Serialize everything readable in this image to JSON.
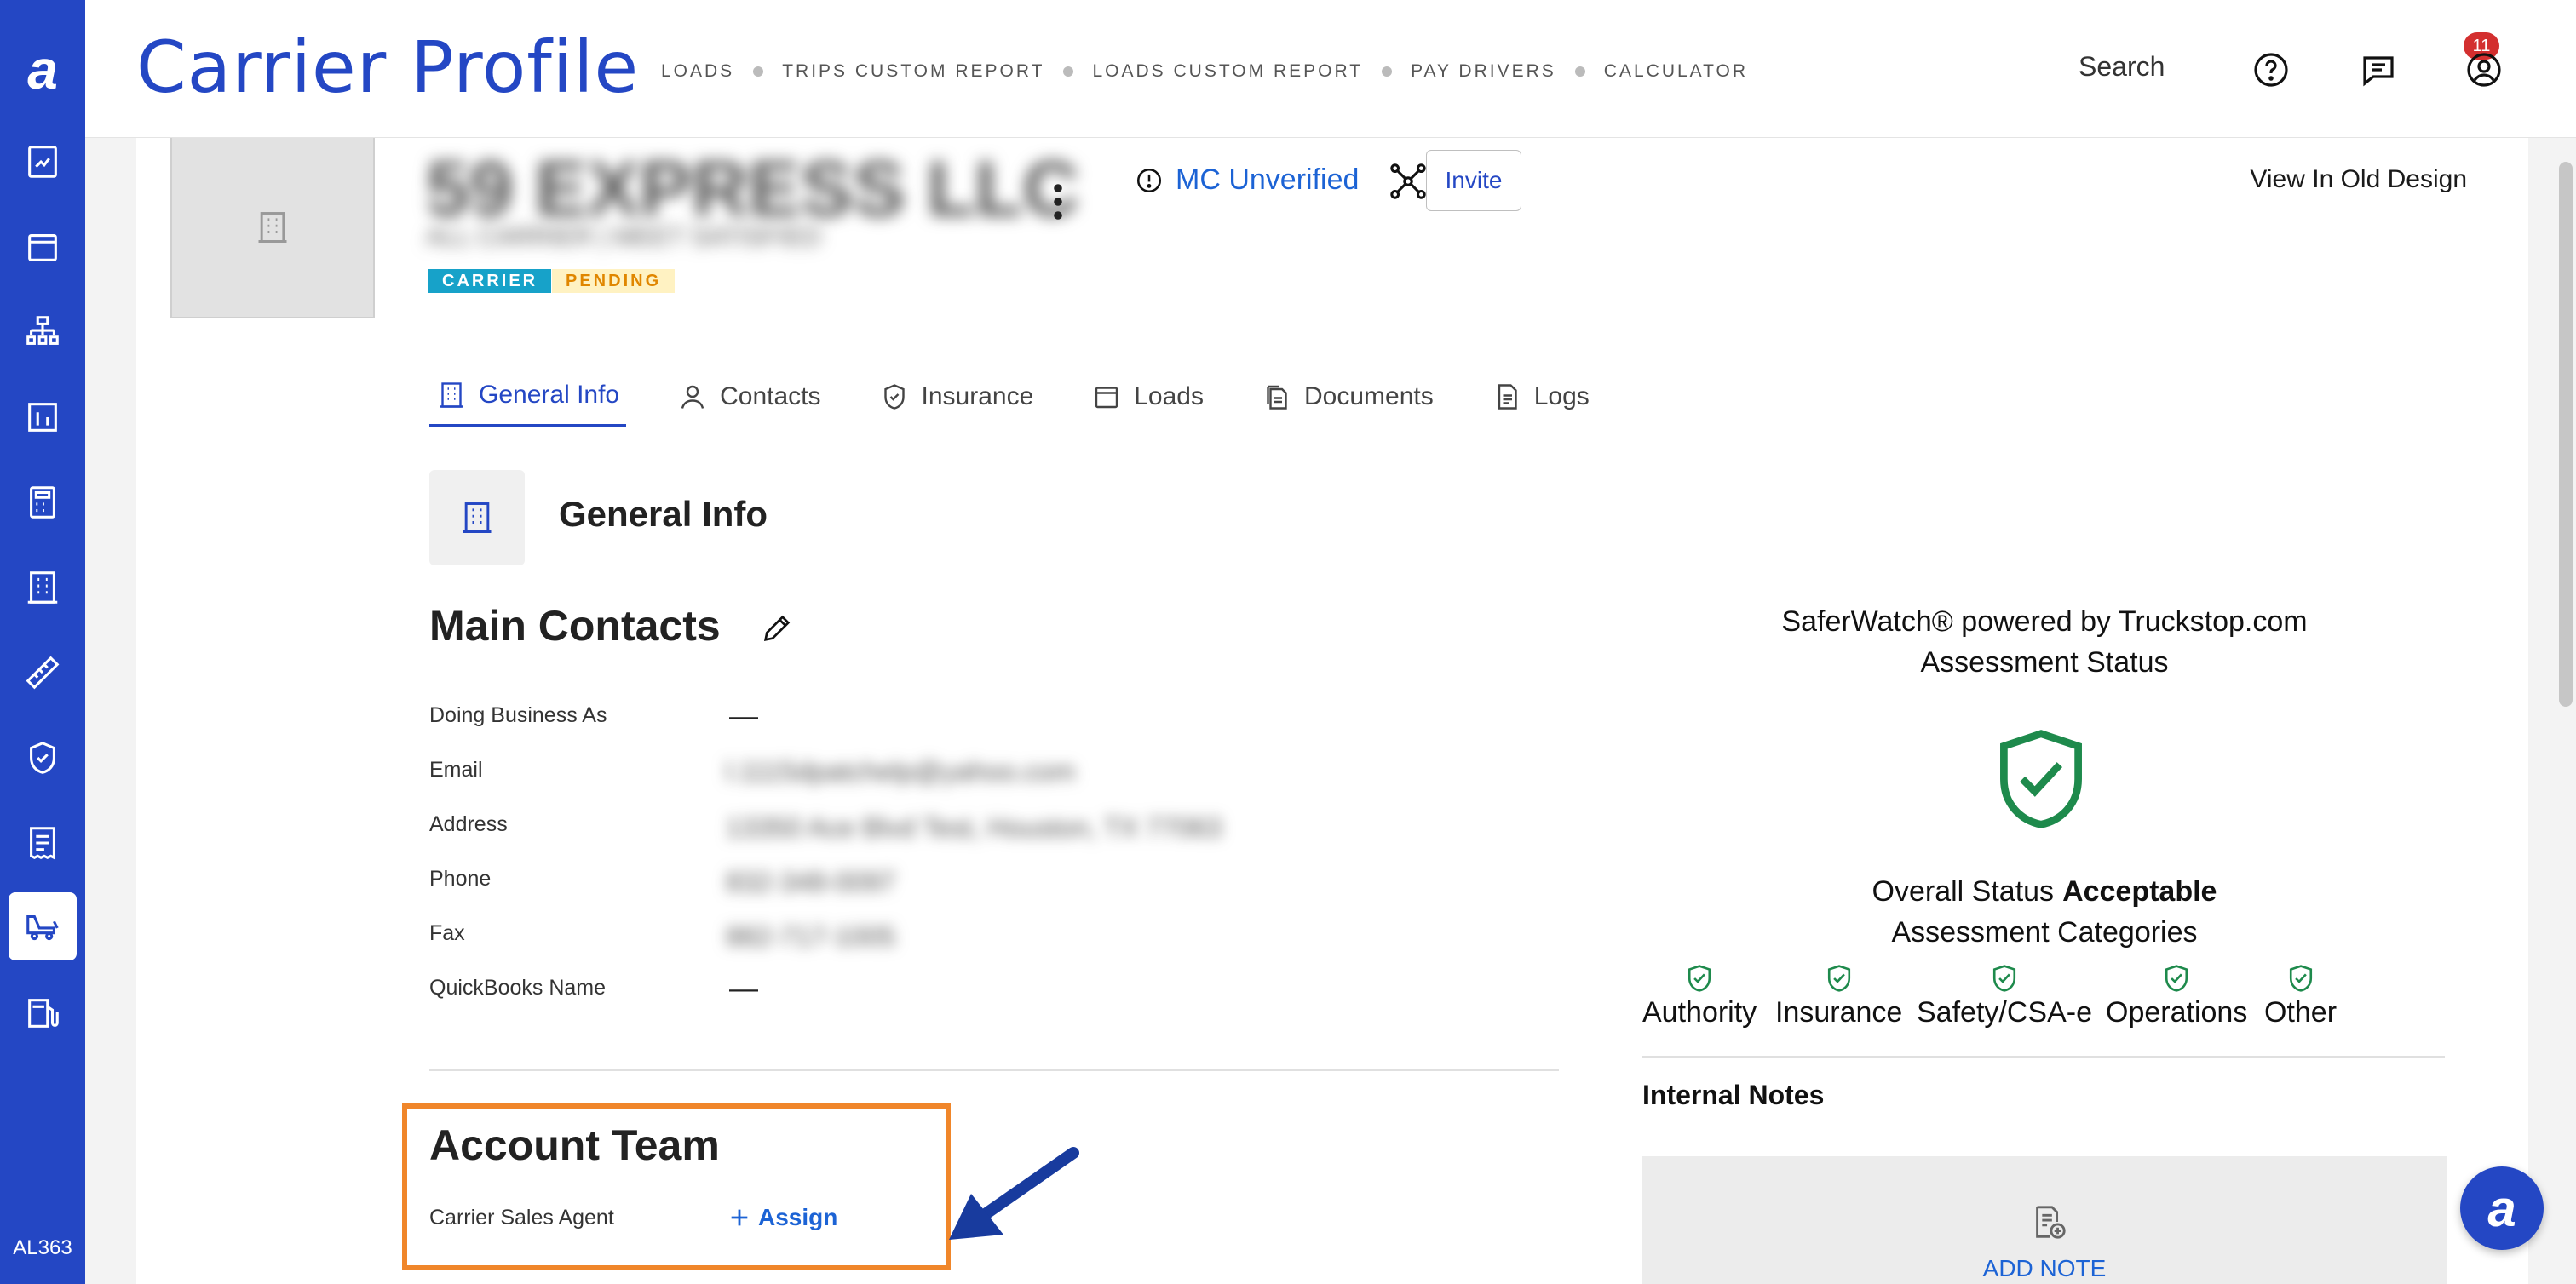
{
  "sidebar": {
    "logo": "a",
    "items": [
      {
        "icon": "report-icon"
      },
      {
        "icon": "box-icon"
      },
      {
        "icon": "hierarchy-icon"
      },
      {
        "icon": "bar-chart-icon"
      },
      {
        "icon": "calculator-icon"
      },
      {
        "icon": "building-icon"
      },
      {
        "icon": "ruler-icon"
      },
      {
        "icon": "shield-check-icon"
      },
      {
        "icon": "receipt-icon"
      },
      {
        "icon": "truck-icon",
        "active": true
      },
      {
        "icon": "fuel-icon"
      }
    ],
    "user_code": "AL363"
  },
  "header": {
    "title": "Carrier Profile",
    "nav": [
      "LOADS",
      "TRIPS CUSTOM REPORT",
      "LOADS CUSTOM REPORT",
      "PAY DRIVERS",
      "CALCULATOR"
    ],
    "search_label": "Search",
    "notification_count": "11"
  },
  "profile": {
    "company_name_blurred": "59 EXPRESS LLC",
    "company_sub_blurred": "ALL CARRIER | MEET SATISFIED",
    "tags": {
      "carrier": "CARRIER",
      "pending": "PENDING"
    },
    "mc_status": "MC Unverified",
    "invite_label": "Invite",
    "old_design_label": "View In Old Design"
  },
  "tabs": [
    "General Info",
    "Contacts",
    "Insurance",
    "Loads",
    "Documents",
    "Logs"
  ],
  "general_info": {
    "section_title": "General Info",
    "main_contacts_title": "Main Contacts",
    "fields": [
      {
        "label": "Doing Business As",
        "value": "—",
        "blurred": false
      },
      {
        "label": "Email",
        "value": "l.1115dpatchelp@yahoo.com",
        "blurred": true
      },
      {
        "label": "Address",
        "value": "13350 Ace Blvd Test, Houston, TX 77063",
        "blurred": true
      },
      {
        "label": "Phone",
        "value": "832-348-0097",
        "blurred": true
      },
      {
        "label": "Fax",
        "value": "882-717-1005",
        "blurred": true
      },
      {
        "label": "QuickBooks Name",
        "value": "—",
        "blurred": false
      }
    ],
    "account_team_title": "Account Team",
    "carrier_sales_agent_label": "Carrier Sales Agent",
    "assign_label": "Assign"
  },
  "saferwatch": {
    "title_line1": "SaferWatch® powered by Truckstop.com",
    "title_line2": "Assessment Status",
    "overall_label": "Overall Status",
    "overall_value": "Acceptable",
    "categories_title": "Assessment Categories",
    "categories": [
      "Authority",
      "Insurance",
      "Safety/CSA-e",
      "Operations",
      "Other"
    ],
    "status_color": "#1e8a4c"
  },
  "notes": {
    "title": "Internal Notes",
    "add_label": "ADD NOTE"
  },
  "colors": {
    "brand": "#2447c4",
    "link": "#1c63d5",
    "highlight": "#f0862a"
  }
}
